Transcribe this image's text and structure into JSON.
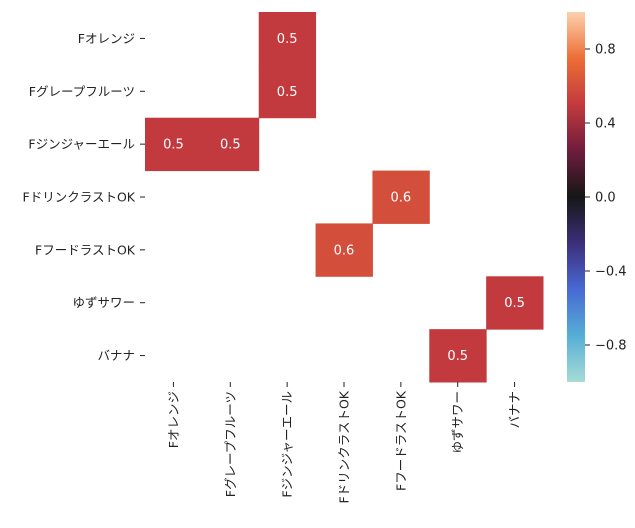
{
  "chart_data": {
    "type": "heatmap",
    "title": "",
    "xlabel": "",
    "ylabel": "",
    "row_labels": [
      "Fオレンジ",
      "Fグレープフルーツ",
      "Fジンジャーエール",
      "FドリンクラストOK",
      "FフードラストOK",
      "ゆずサワー",
      "バナナ"
    ],
    "col_labels": [
      "Fオレンジ",
      "Fグレープフルーツ",
      "Fジンジャーエール",
      "FドリンクラストOK",
      "FフードラストOK",
      "ゆずサワー",
      "バナナ"
    ],
    "values": [
      [
        null,
        null,
        0.5,
        null,
        null,
        null,
        null
      ],
      [
        null,
        null,
        0.5,
        null,
        null,
        null,
        null
      ],
      [
        0.5,
        0.5,
        null,
        null,
        null,
        null,
        null
      ],
      [
        null,
        null,
        null,
        null,
        0.6,
        null,
        null
      ],
      [
        null,
        null,
        null,
        0.6,
        null,
        null,
        null
      ],
      [
        null,
        null,
        null,
        null,
        null,
        null,
        0.5
      ],
      [
        null,
        null,
        null,
        null,
        null,
        0.5,
        null
      ]
    ],
    "annotations": [
      [
        null,
        null,
        "0.5",
        null,
        null,
        null,
        null
      ],
      [
        null,
        null,
        "0.5",
        null,
        null,
        null,
        null
      ],
      [
        "0.5",
        "0.5",
        null,
        null,
        null,
        null,
        null
      ],
      [
        null,
        null,
        null,
        null,
        "0.6",
        null,
        null
      ],
      [
        null,
        null,
        null,
        "0.6",
        null,
        null,
        null
      ],
      [
        null,
        null,
        null,
        null,
        null,
        null,
        "0.5"
      ],
      [
        null,
        null,
        null,
        null,
        null,
        "0.5",
        null
      ]
    ],
    "colorbar": {
      "vmin": -1.0,
      "vmax": 1.0,
      "ticks": [
        0.8,
        0.4,
        0.0,
        -0.4,
        -0.8
      ],
      "tick_labels": [
        "0.8",
        "0.4",
        "0.0",
        "−0.4",
        "−0.8"
      ],
      "colormap": "icefire",
      "stops": [
        "#a6dcd6",
        "#56aed6",
        "#4869d4",
        "#3c2f7a",
        "#161616",
        "#6e1d3c",
        "#c23a3e",
        "#ec6e36",
        "#fdd1ad"
      ]
    },
    "grid": false
  }
}
